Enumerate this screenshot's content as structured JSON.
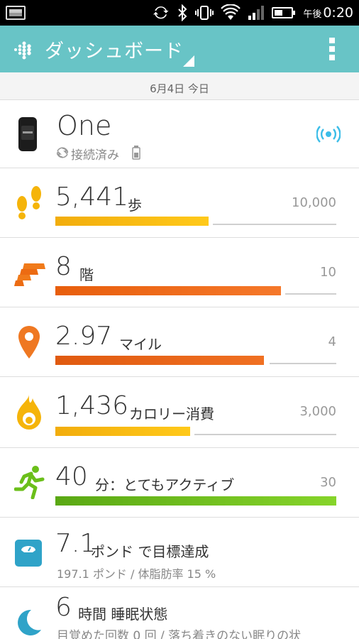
{
  "status_bar": {
    "ampm": "午後",
    "time": "0:20"
  },
  "app_bar": {
    "title": "ダッシュボード"
  },
  "date_label": "6月4日 今日",
  "device": {
    "name": "One",
    "status": "接続済み"
  },
  "stats": [
    {
      "value": "5,441",
      "unit": "歩",
      "goal": "10,000",
      "progress": 0.544,
      "color": "#f5b40a",
      "icon": "footprints-icon"
    },
    {
      "value": "8",
      "unit": "階",
      "goal": "10",
      "progress": 0.8,
      "color": "#ec6b12",
      "icon": "stairs-icon"
    },
    {
      "value": "2.97",
      "unit": "マイル",
      "goal": "4",
      "progress": 0.74,
      "color": "#e8661a",
      "icon": "location-pin-icon"
    },
    {
      "value": "1,436",
      "unit": "カロリー消費",
      "goal": "3,000",
      "progress": 0.48,
      "color": "#f5b40a",
      "icon": "flame-icon"
    },
    {
      "value": "40",
      "unit": "分：とてもアクティブ",
      "goal": "30",
      "progress": 1.0,
      "color": "#6bbf1a",
      "icon": "running-person-icon"
    }
  ],
  "weight": {
    "value": "7.1",
    "unit": "ポンド で目標達成",
    "detail": "197.1 ポンド / 体脂肪率 15 %"
  },
  "sleep": {
    "value": "6",
    "unit": "時間 睡眠状態",
    "detail": "目覚めた回数 0 回 / 落ち着きのない眠りの状"
  },
  "colors": {
    "app_bar": "#68c4c6",
    "steps": "#f5b40a",
    "floors": "#ec6b12",
    "distance": "#e8661a",
    "calories": "#f5b40a",
    "active": "#6bbf1a",
    "sync_accent": "#3bbde8",
    "weight_icon": "#2fa3c8",
    "sleep_icon": "#2fa3c8"
  }
}
